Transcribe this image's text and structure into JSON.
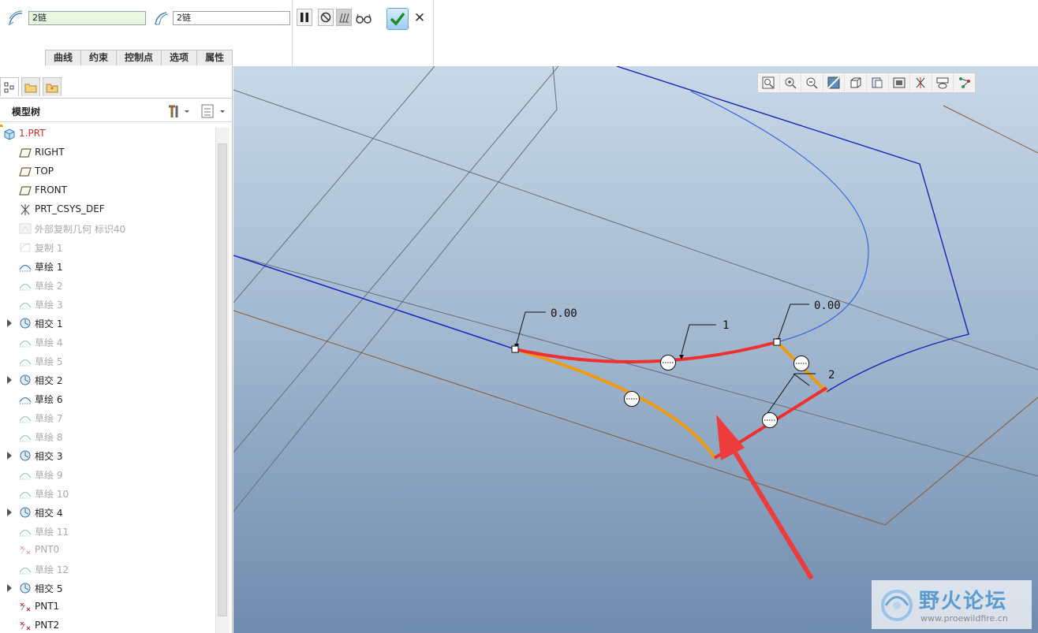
{
  "dashboard": {
    "chain_field_1": "2链",
    "chain_field_2": "2链",
    "tabs": [
      "曲线",
      "约束",
      "控制点",
      "选项",
      "属性"
    ],
    "controls": [
      "pause-icon",
      "no-preview-icon",
      "verify-icon",
      "glasses-icon"
    ],
    "ok_icon": "check-icon",
    "cancel_icon": "close-icon",
    "cancel_glyph": "✕"
  },
  "navigator": {
    "title": "模型树",
    "tree": [
      {
        "label": "1.PRT",
        "icon": "part-icon",
        "state": "red",
        "expandable": false
      },
      {
        "label": "RIGHT",
        "icon": "datum-plane-icon",
        "state": "normal",
        "expandable": false
      },
      {
        "label": "TOP",
        "icon": "datum-plane-icon",
        "state": "normal",
        "expandable": false
      },
      {
        "label": "FRONT",
        "icon": "datum-plane-icon",
        "state": "normal",
        "expandable": false
      },
      {
        "label": "PRT_CSYS_DEF",
        "icon": "csys-icon",
        "state": "normal",
        "expandable": false
      },
      {
        "label": "外部复制几何 标识40",
        "icon": "copy-geom-icon",
        "state": "dim",
        "expandable": false
      },
      {
        "label": "复制 1",
        "icon": "copy-icon",
        "state": "dim",
        "expandable": false
      },
      {
        "label": "草绘 1",
        "icon": "sketch-icon",
        "state": "normal",
        "expandable": false
      },
      {
        "label": "草绘 2",
        "icon": "sketch-icon",
        "state": "dim",
        "expandable": false
      },
      {
        "label": "草绘 3",
        "icon": "sketch-icon",
        "state": "dim",
        "expandable": false
      },
      {
        "label": "相交 1",
        "icon": "intersect-icon",
        "state": "normal",
        "expandable": true
      },
      {
        "label": "草绘 4",
        "icon": "sketch-icon",
        "state": "dim",
        "expandable": false
      },
      {
        "label": "草绘 5",
        "icon": "sketch-icon",
        "state": "dim",
        "expandable": false
      },
      {
        "label": "相交 2",
        "icon": "intersect-icon",
        "state": "normal",
        "expandable": true
      },
      {
        "label": "草绘 6",
        "icon": "sketch-icon",
        "state": "normal",
        "expandable": false
      },
      {
        "label": "草绘 7",
        "icon": "sketch-icon",
        "state": "dim",
        "expandable": false
      },
      {
        "label": "草绘 8",
        "icon": "sketch-icon",
        "state": "dim",
        "expandable": false
      },
      {
        "label": "相交 3",
        "icon": "intersect-icon",
        "state": "normal",
        "expandable": true
      },
      {
        "label": "草绘 9",
        "icon": "sketch-icon",
        "state": "dim",
        "expandable": false
      },
      {
        "label": "草绘 10",
        "icon": "sketch-icon",
        "state": "dim",
        "expandable": false
      },
      {
        "label": "相交 4",
        "icon": "intersect-icon",
        "state": "normal",
        "expandable": true
      },
      {
        "label": "草绘 11",
        "icon": "sketch-icon",
        "state": "dim",
        "expandable": false
      },
      {
        "label": "PNT0",
        "icon": "point-icon",
        "state": "dim",
        "expandable": false
      },
      {
        "label": "草绘 12",
        "icon": "sketch-icon",
        "state": "dim",
        "expandable": false
      },
      {
        "label": "相交 5",
        "icon": "intersect-icon",
        "state": "normal",
        "expandable": true
      },
      {
        "label": "PNT1",
        "icon": "point-icon",
        "state": "normal",
        "expandable": false
      },
      {
        "label": "PNT2",
        "icon": "point-icon",
        "state": "normal",
        "expandable": false
      }
    ]
  },
  "graphics": {
    "view_toolbar": [
      "refit-icon",
      "zoom-in-icon",
      "zoom-out-icon",
      "repaint-icon",
      "display-style-icon",
      "saved-views-icon",
      "view-manager-icon",
      "datum-display-icon",
      "annotation-display-icon",
      "spin-center-icon"
    ],
    "annotations": {
      "dim_left": "0.00",
      "dim_right": "0.00",
      "label_1": "1",
      "label_2": "2"
    },
    "colors": {
      "edge_blue": "#1a23b8",
      "curve_red": "#f03030",
      "curve_orange": "#f09a10",
      "arrow_red": "#ee3b3b",
      "datum_brown": "#8a5a36",
      "datum_gray": "#6a6f78"
    }
  },
  "watermark": {
    "title": "野火论坛",
    "url": "www.proewildfire.cn"
  }
}
